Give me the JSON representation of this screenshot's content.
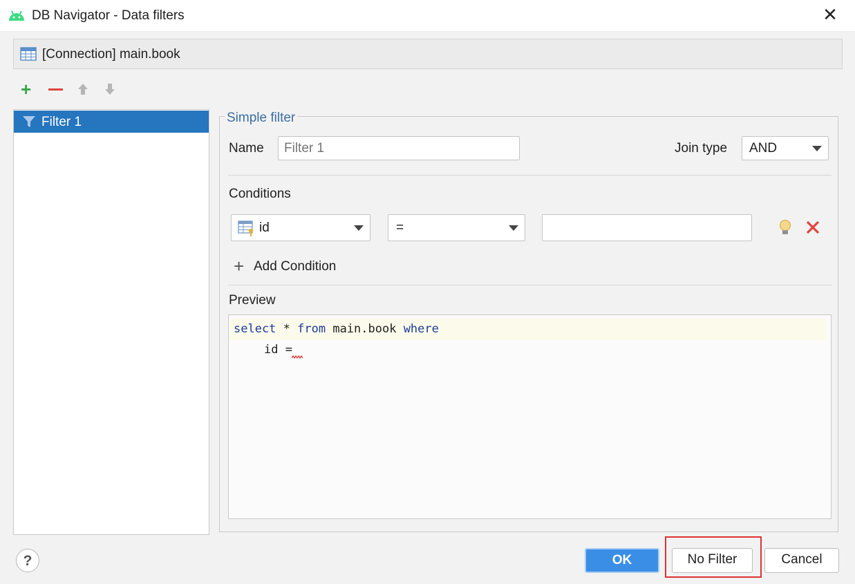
{
  "window": {
    "title": "DB Navigator - Data filters",
    "close_icon": "close-icon",
    "app_icon": "android-icon"
  },
  "connection": {
    "label": "[Connection] main.book",
    "icon": "table-icon"
  },
  "toolbar": {
    "add_icon": "plus-icon",
    "remove_icon": "minus-icon",
    "up_icon": "arrow-up-icon",
    "down_icon": "arrow-down-icon"
  },
  "filters": [
    {
      "label": "Filter 1",
      "icon": "filter-icon",
      "selected": true
    }
  ],
  "simple_filter": {
    "legend": "Simple filter",
    "name_label": "Name",
    "name_placeholder": "Filter 1",
    "name_value": "",
    "join_type_label": "Join type",
    "join_type_value": "AND"
  },
  "conditions": {
    "label": "Conditions",
    "rows": [
      {
        "column": "id",
        "column_icon": "primary-key-column-icon",
        "operator": "=",
        "value": ""
      }
    ],
    "add_label": "Add Condition"
  },
  "preview": {
    "label": "Preview",
    "line1": {
      "kw1": "select",
      "t1": " * ",
      "kw2": "from",
      "t2": " main.book ",
      "kw3": "where"
    },
    "line2": "id ="
  },
  "buttons": {
    "ok": "OK",
    "no_filter": "No Filter",
    "cancel": "Cancel",
    "help": "?"
  },
  "colors": {
    "accent": "#2675bf",
    "ok_button": "#3a8ee6",
    "highlight_box": "#e03131",
    "sql_keyword": "#1a3d9c",
    "add_green": "#3aa64a",
    "remove_red": "#e0443e"
  }
}
